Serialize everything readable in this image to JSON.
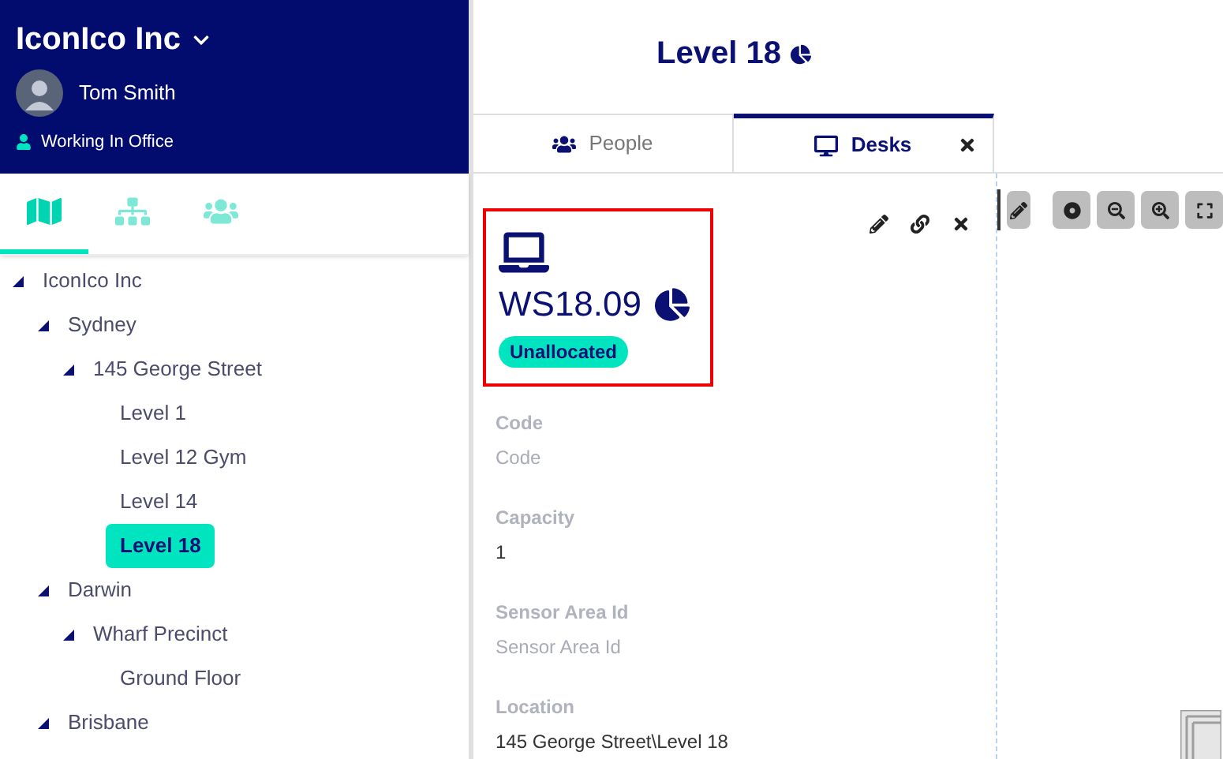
{
  "organisation": {
    "name": "IconIco Inc"
  },
  "user": {
    "name": "Tom Smith",
    "status": "Working In Office"
  },
  "sidebar_tabs": [
    {
      "kind": "map",
      "selected": true
    },
    {
      "kind": "hierarchy",
      "selected": false
    },
    {
      "kind": "people",
      "selected": false
    }
  ],
  "tree": [
    {
      "label": "IconIco Inc",
      "expanded": true,
      "selected": false,
      "children": [
        {
          "label": "Sydney",
          "expanded": true,
          "selected": false,
          "children": [
            {
              "label": "145 George Street",
              "expanded": true,
              "selected": false,
              "children": [
                {
                  "label": "Level 1",
                  "selected": false
                },
                {
                  "label": "Level 12 Gym",
                  "selected": false
                },
                {
                  "label": "Level 14",
                  "selected": false
                },
                {
                  "label": "Level 18",
                  "selected": true
                }
              ]
            }
          ]
        },
        {
          "label": "Darwin",
          "expanded": true,
          "selected": false,
          "children": [
            {
              "label": "Wharf Precinct",
              "expanded": true,
              "selected": false,
              "children": [
                {
                  "label": "Ground Floor",
                  "selected": false
                }
              ]
            }
          ]
        },
        {
          "label": "Brisbane",
          "expanded": true,
          "selected": false
        }
      ]
    }
  ],
  "page_title": "Level 18",
  "tabs": [
    {
      "kind": "people",
      "label": "People",
      "selected": false,
      "closable": false
    },
    {
      "kind": "desks",
      "label": "Desks",
      "selected": true,
      "closable": true
    }
  ],
  "desk": {
    "name": "WS18.09",
    "status": "Unallocated"
  },
  "fields": [
    {
      "label": "Code",
      "placeholder": "Code"
    },
    {
      "label": "Capacity",
      "value": "1"
    },
    {
      "label": "Sensor Area Id",
      "placeholder": "Sensor Area Id"
    },
    {
      "label": "Location",
      "value": "145 George Street\\Level 18"
    }
  ]
}
